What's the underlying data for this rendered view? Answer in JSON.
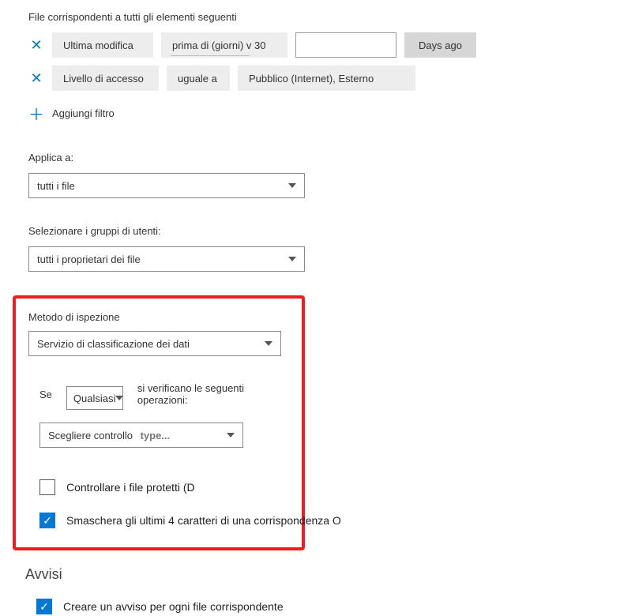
{
  "filters": {
    "heading": "File corrispondenti a tutti gli elementi seguenti",
    "rows": [
      {
        "field": "Ultima modifica",
        "operator": "prima di (giorni) v 30",
        "days_label": "Days ago"
      },
      {
        "field": "Livello di accesso",
        "operator": "uguale a",
        "value": "Pubblico (Internet), Esterno"
      }
    ],
    "add_label": "Aggiungi filtro"
  },
  "apply_to": {
    "label": "Applica a:",
    "value": "tutti i file"
  },
  "user_groups": {
    "label": "Selezionare i gruppi di utenti:",
    "value": "tutti i proprietari dei file"
  },
  "inspection": {
    "label": "Metodo di ispezione",
    "value": "Servizio di classificazione dei dati",
    "if_label": "Se",
    "any_value": "Qualsiasi",
    "following_label": "si verificano le seguenti operazioni:",
    "choose_label": "Scegliere controllo",
    "choose_placeholder": "type...",
    "cb1_label": "Controllare i file protetti (D",
    "cb2_label": "Smaschera gli ultimi 4 caratteri di una corrispondenza O"
  },
  "alerts": {
    "heading": "Avvisi",
    "cb1_label": "Creare un avviso per ogni file corrispondente"
  }
}
